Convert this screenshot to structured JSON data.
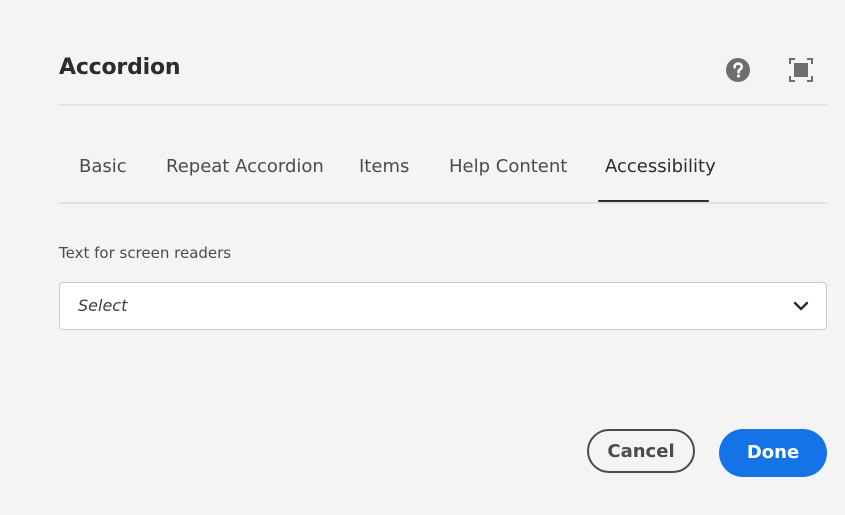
{
  "dialog": {
    "title": "Accordion",
    "icons": {
      "help": "help-circle-icon",
      "fullscreen": "fullscreen-icon"
    }
  },
  "tabs": [
    {
      "label": "Basic",
      "selected": false
    },
    {
      "label": "Repeat Accordion",
      "selected": false
    },
    {
      "label": "Items",
      "selected": false
    },
    {
      "label": "Help Content",
      "selected": false
    },
    {
      "label": "Accessibility",
      "selected": true
    }
  ],
  "accessibility": {
    "field_label": "Text for screen readers",
    "select_value": "Select"
  },
  "footer": {
    "cancel_label": "Cancel",
    "done_label": "Done"
  },
  "colors": {
    "background": "#f4f4f4",
    "accent": "#1473e6",
    "text": "#2c2c2c"
  }
}
